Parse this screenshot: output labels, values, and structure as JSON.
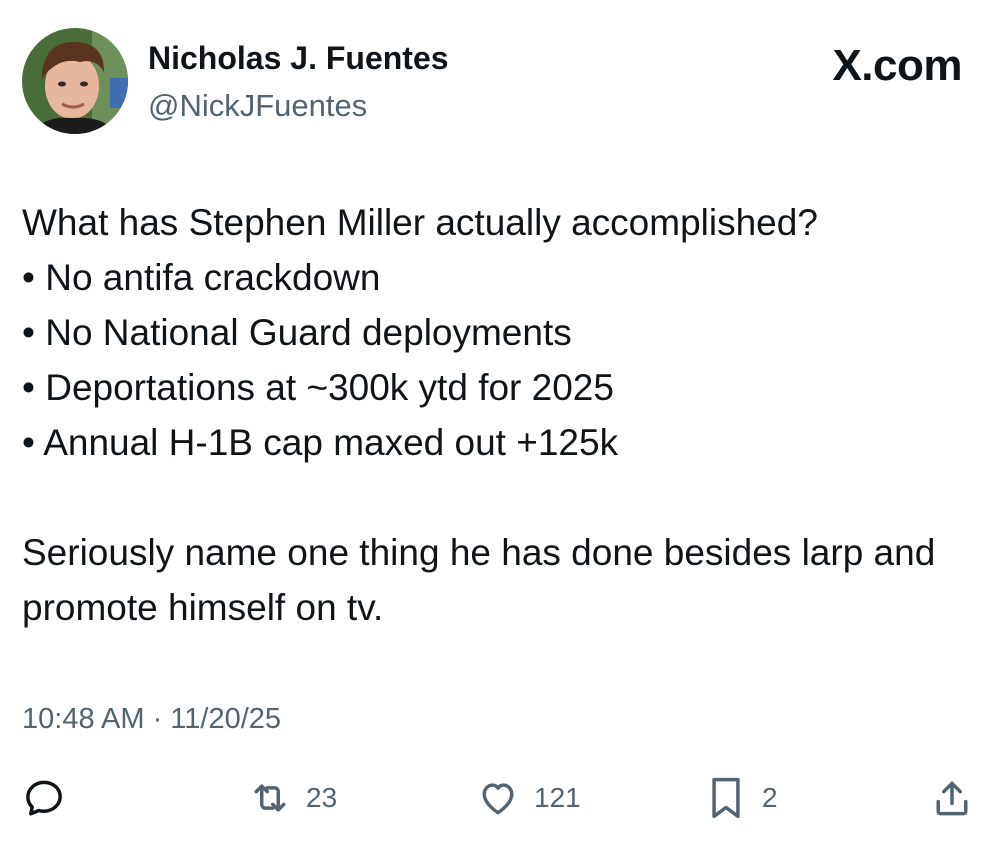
{
  "author": {
    "display_name": "Nicholas J. Fuentes",
    "handle": "@NickJFuentes"
  },
  "brand": {
    "label": "X.com"
  },
  "tweet": {
    "lines": [
      "What has Stephen Miller actually accomplished?",
      "• No antifa crackdown",
      "• No National Guard deployments",
      "• Deportations at ~300k ytd for 2025",
      "• Annual H-1B cap maxed out +125k"
    ],
    "closing": "Seriously name one thing he has done besides larp and promote himself on tv.",
    "timestamp": "10:48 AM · 11/20/25"
  },
  "actions": {
    "reply": {
      "icon": "reply-icon"
    },
    "repost": {
      "icon": "repost-icon",
      "count": "23"
    },
    "like": {
      "icon": "heart-icon",
      "count": "121"
    },
    "bookmark": {
      "icon": "bookmark-icon",
      "count": "2"
    },
    "share": {
      "icon": "share-icon"
    }
  },
  "colors": {
    "text_primary": "#0f1419",
    "text_secondary": "#536471"
  }
}
